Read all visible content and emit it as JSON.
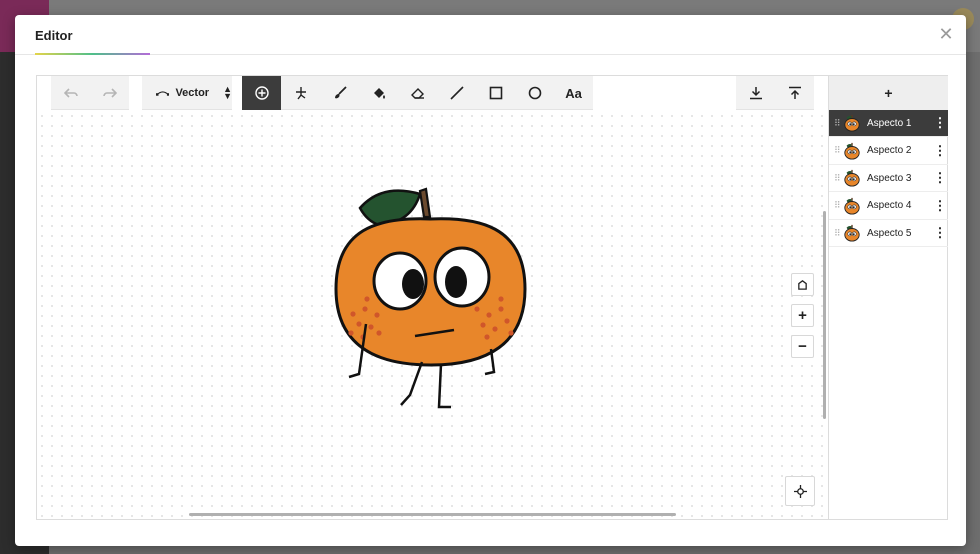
{
  "dialog": {
    "title": "Editor",
    "close_icon": "close-icon",
    "title_gradient": [
      "#e4d44a",
      "#4fbf8a",
      "#b46bd8"
    ]
  },
  "toolbar": {
    "undo_icon": "undo-icon",
    "redo_icon": "redo-icon",
    "mode_label": "Vector",
    "tools": [
      "select-tool",
      "reshape-tool",
      "brush-tool",
      "fill-tool",
      "eraser-tool",
      "line-tool",
      "rectangle-tool",
      "ellipse-tool",
      "text-tool"
    ],
    "active_tool": "select-tool",
    "text_tool_label": "Aa",
    "download_icon": "download-icon",
    "upload_icon": "upload-icon"
  },
  "canvas": {
    "zoom_reset_icon": "zoom-reset-icon",
    "zoom_in_label": "+",
    "zoom_out_label": "−",
    "center_icon": "crosshair-icon",
    "character": "orange-character"
  },
  "costumes": {
    "add_label": "+",
    "items": [
      {
        "label": "Aspecto 1",
        "selected": true
      },
      {
        "label": "Aspecto 2",
        "selected": false
      },
      {
        "label": "Aspecto 3",
        "selected": false
      },
      {
        "label": "Aspecto 4",
        "selected": false
      },
      {
        "label": "Aspecto 5",
        "selected": false
      }
    ],
    "menu_label": "⋮"
  },
  "colors": {
    "accent_dark": "#3c3c3c",
    "orange_body": "#e8862a",
    "leaf": "#24532f",
    "app_brand": "#7a2a58"
  }
}
